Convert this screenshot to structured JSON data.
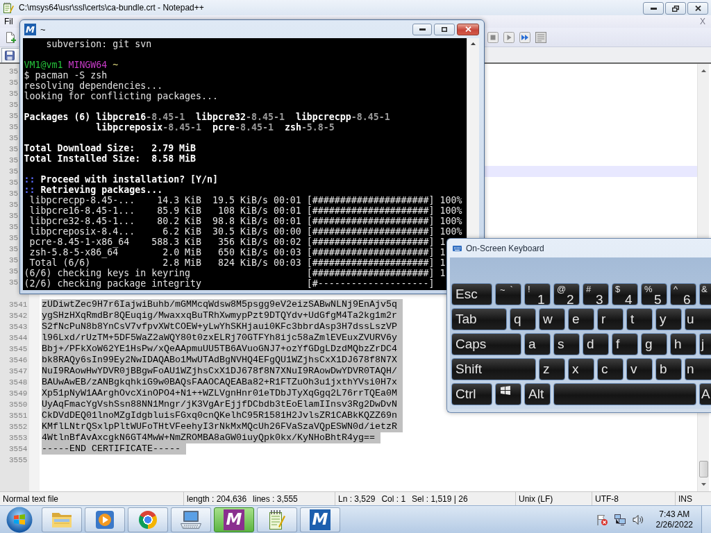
{
  "notepad": {
    "title": "C:\\msys64\\usr\\ssl\\certs\\ca-bundle.crt - Notepad++",
    "menu": {
      "items": [
        "Fil"
      ],
      "close": "X"
    },
    "editor": {
      "lines": [
        {
          "number": "35",
          "current": false
        },
        {
          "number": "35",
          "current": false
        },
        {
          "number": "35",
          "current": false
        },
        {
          "number": "35",
          "current": false
        },
        {
          "number": "35",
          "current": false
        },
        {
          "number": "35",
          "current": false
        },
        {
          "number": "35",
          "current": false
        },
        {
          "number": "35",
          "current": false
        },
        {
          "number": "35",
          "current": false
        },
        {
          "number": "35",
          "current": true
        },
        {
          "number": "35",
          "current": false
        },
        {
          "number": "35",
          "current": false
        },
        {
          "number": "35",
          "current": false
        },
        {
          "number": "35",
          "current": false
        },
        {
          "number": "35",
          "current": false
        },
        {
          "number": "35",
          "current": false
        },
        {
          "number": "35",
          "current": false
        },
        {
          "number": "35",
          "current": false
        },
        {
          "number": "35",
          "current": false
        },
        {
          "number": "35",
          "current": false
        },
        {
          "current": false
        },
        {
          "number": "3541",
          "text": "zUDiwtZec9H7r6IajwiBuhb/mGMMcqWdsw8M5psgg9eV2eizSABwNLNj9EnAjv5q",
          "selected": true,
          "current": false
        },
        {
          "number": "3542",
          "text": "ygSHzHXqRmdBr8QEuqig/MwaxxqBuTRhXwmypPzt9DTQYdv+UdGfgM4Ta2kg1m2r",
          "selected": true,
          "current": false
        },
        {
          "number": "3543",
          "text": "S2fNcPuN8b8YnCsV7vfpvXWtCOEW+yLwYhSKHjaui0KFc3bbrdAsp3H7dssLszVP",
          "selected": true,
          "current": false
        },
        {
          "number": "3544",
          "text": "l96Lxd/rUzTM+5DF5WaZ2aWQY80t0zxELRj70GTFYh8ijc58aZmlEVEuxZVURV6y",
          "selected": true,
          "current": false
        },
        {
          "number": "3545",
          "text": "Bbj+/PFkXoW62YE1HsPw/xQeAApmuUU5TB6AVuoGNJ7+ozYfGDgLDzdMQbzZrDC4",
          "selected": true,
          "current": false
        },
        {
          "number": "3546",
          "text": "bk8RAQy6sIn99Ey2NwIDAQABo1MwUTAdBgNVHQ4EFgQU1WZjhsCxX1DJ678f8N7X",
          "selected": true,
          "current": false
        },
        {
          "number": "3547",
          "text": "NuI9RAowHwYDVR0jBBgwFoAU1WZjhsCxX1DJ678f8N7XNuI9RAowDwYDVR0TAQH/",
          "selected": true,
          "current": false
        },
        {
          "number": "3548",
          "text": "BAUwAwEB/zANBgkqhkiG9w0BAQsFAAOCAQEABa82+R1FTZuOh3u1jxthYVsi0H7x",
          "selected": true,
          "current": false
        },
        {
          "number": "3549",
          "text": "Xp51pNyW1AArghOvcXinOPO4+N1++WZLVgnHnr01eTDbJTyXqGgq2L76rrTQEa0M",
          "selected": true,
          "current": false
        },
        {
          "number": "3550",
          "text": "UyAqFmacYgVshSsn88NN1Mngr/jK3VgArEjjfDCbdb3tEoElamIInsv3Rg2DwDvN",
          "selected": true,
          "current": false
        },
        {
          "number": "3551",
          "text": "CkDVdDEQ01lnoMZgIdgbluisFGxq0cnQKelhC95R1581H2JvlsZR1CABkKQZZ69n",
          "selected": true,
          "current": false
        },
        {
          "number": "3552",
          "text": "KMflLNtrQSxlpPltWUFoTHtVFeehyI3rNkMxMQcUh26FVaSzaVQpESWN0d/ietzR",
          "selected": true,
          "current": false
        },
        {
          "number": "3553",
          "text": "4WtlnBfAvAxcgkN6GT4MwW+NmZROMBA8aGW0iuyQpk0kx/KyNHoBhtR4yg==",
          "selected": true,
          "current": false
        },
        {
          "number": "3554",
          "text": "-----END CERTIFICATE-----",
          "selected": true,
          "current": false
        },
        {
          "number": "3555",
          "selected": false,
          "current": false
        }
      ]
    },
    "status_bar": [
      {
        "items": [
          "Normal text file"
        ]
      },
      {
        "items": [
          "length : 204,636",
          "lines : 3,555"
        ]
      },
      {
        "items": [
          "Ln : 3,529",
          "Col : 1",
          "Sel : 1,519 | 26"
        ]
      },
      {
        "items": [
          "Unix (LF)"
        ]
      },
      {
        "items": [
          "UTF-8"
        ]
      },
      {
        "items": [
          "INS"
        ]
      }
    ]
  },
  "terminal": {
    "logo": "M",
    "title": "~",
    "lines": [
      {
        "kind": "text",
        "segments": [
          {
            "text": "    subversion: git svn",
            "kind": "normal"
          }
        ]
      },
      {
        "kind": "blank"
      },
      {
        "kind": "text",
        "segments": [
          {
            "text": "VM1@vm1 ",
            "kind": "user"
          },
          {
            "text": "MINGW64 ",
            "kind": "host"
          },
          {
            "text": "~",
            "kind": "path"
          }
        ]
      },
      {
        "kind": "text",
        "segments": [
          {
            "text": "$ pacman -S zsh",
            "kind": "normal"
          }
        ]
      },
      {
        "kind": "text",
        "segments": [
          {
            "text": "resolving dependencies...",
            "kind": "normal"
          }
        ]
      },
      {
        "kind": "text",
        "segments": [
          {
            "text": "looking for conflicting packages...",
            "kind": "normal"
          }
        ]
      },
      {
        "kind": "blank"
      },
      {
        "kind": "text",
        "segments": [
          {
            "text": "Packages (6) libpcre16",
            "kind": "bold"
          },
          {
            "text": "-8.45-1  ",
            "kind": "dim"
          },
          {
            "text": "libpcre32",
            "kind": "bold"
          },
          {
            "text": "-8.45-1  ",
            "kind": "dim"
          },
          {
            "text": "libpcrecpp",
            "kind": "bold"
          },
          {
            "text": "-8.45-1",
            "kind": "dim"
          }
        ]
      },
      {
        "kind": "text",
        "segments": [
          {
            "text": "             libpcreposix",
            "kind": "bold"
          },
          {
            "text": "-8.45-1  ",
            "kind": "dim"
          },
          {
            "text": "pcre",
            "kind": "bold"
          },
          {
            "text": "-8.45-1  ",
            "kind": "dim"
          },
          {
            "text": "zsh",
            "kind": "bold"
          },
          {
            "text": "-5.8-5",
            "kind": "dim"
          }
        ]
      },
      {
        "kind": "blank"
      },
      {
        "kind": "text",
        "segments": [
          {
            "text": "Total Download Size:   2.79 MiB",
            "kind": "bold"
          }
        ]
      },
      {
        "kind": "text",
        "segments": [
          {
            "text": "Total Installed Size:  8.58 MiB",
            "kind": "bold"
          }
        ]
      },
      {
        "kind": "blank"
      },
      {
        "kind": "text",
        "segments": [
          {
            "text": ":: ",
            "kind": "marker"
          },
          {
            "text": "Proceed with installation? [Y/n]",
            "kind": "bold"
          }
        ]
      },
      {
        "kind": "text",
        "segments": [
          {
            "text": ":: ",
            "kind": "marker"
          },
          {
            "text": "Retrieving packages...",
            "kind": "bold"
          }
        ]
      },
      {
        "kind": "text",
        "segments": [
          {
            "text": " libpcrecpp-8.45-...    14.3 KiB  19.5 KiB/s 00:01 [#####################] 100%",
            "kind": "normal"
          }
        ]
      },
      {
        "kind": "text",
        "segments": [
          {
            "text": " libpcre16-8.45-1...    85.9 KiB   108 KiB/s 00:01 [#####################] 100%",
            "kind": "normal"
          }
        ]
      },
      {
        "kind": "text",
        "segments": [
          {
            "text": " libpcre32-8.45-1...    80.2 KiB  98.8 KiB/s 00:01 [#####################] 100%",
            "kind": "normal"
          }
        ]
      },
      {
        "kind": "text",
        "segments": [
          {
            "text": " libpcreposix-8.4...     6.2 KiB  30.5 KiB/s 00:00 [#####################] 100%",
            "kind": "normal"
          }
        ]
      },
      {
        "kind": "text",
        "segments": [
          {
            "text": " pcre-8.45-1-x86_64    588.3 KiB   356 KiB/s 00:02 [#####################] 1",
            "kind": "normal"
          }
        ]
      },
      {
        "kind": "text",
        "segments": [
          {
            "text": " zsh-5.8-5-x86_64        2.0 MiB   650 KiB/s 00:03 [#####################] 1",
            "kind": "normal"
          }
        ]
      },
      {
        "kind": "text",
        "segments": [
          {
            "text": " Total (6/6)             2.8 MiB   824 KiB/s 00:03 [#####################] 1",
            "kind": "normal"
          }
        ]
      },
      {
        "kind": "text",
        "segments": [
          {
            "text": "(6/6) checking keys in keyring                     [#####################] 1",
            "kind": "normal"
          }
        ]
      },
      {
        "kind": "text",
        "segments": [
          {
            "text": "(2/6) checking package integrity                   [#--------------------]",
            "kind": "normal"
          }
        ]
      }
    ]
  },
  "keyboard": {
    "title": "On-Screen Keyboard",
    "rows": [
      {
        "keys": [
          {
            "kind": "esc",
            "label": "Esc"
          },
          {
            "kind": "pair",
            "shift": "~",
            "label": "`"
          },
          {
            "kind": "dual",
            "shift": "!",
            "label": "1"
          },
          {
            "kind": "dual",
            "shift": "@",
            "label": "2"
          },
          {
            "kind": "dual",
            "shift": "#",
            "label": "3"
          },
          {
            "kind": "dual",
            "shift": "$",
            "label": "4"
          },
          {
            "kind": "dual",
            "shift": "%",
            "label": "5"
          },
          {
            "kind": "dual",
            "shift": "^",
            "label": "6"
          },
          {
            "kind": "dual",
            "shift": "&"
          }
        ]
      },
      {
        "keys": [
          {
            "kind": "tab",
            "label": "Tab"
          },
          {
            "kind": "letter",
            "label": "q"
          },
          {
            "kind": "letter",
            "label": "w"
          },
          {
            "kind": "letter",
            "label": "e"
          },
          {
            "kind": "letter",
            "label": "r"
          },
          {
            "kind": "letter",
            "label": "t"
          },
          {
            "kind": "letter",
            "label": "y"
          },
          {
            "kind": "letter",
            "label": "u"
          }
        ]
      },
      {
        "keys": [
          {
            "kind": "caps",
            "label": "Caps"
          },
          {
            "kind": "letter",
            "label": "a"
          },
          {
            "kind": "letter",
            "label": "s"
          },
          {
            "kind": "letter",
            "label": "d"
          },
          {
            "kind": "letter",
            "label": "f"
          },
          {
            "kind": "letter",
            "label": "g"
          },
          {
            "kind": "letter",
            "label": "h"
          },
          {
            "kind": "letter",
            "label": "j"
          }
        ]
      },
      {
        "keys": [
          {
            "kind": "shift",
            "label": "Shift"
          },
          {
            "kind": "letter",
            "label": "z"
          },
          {
            "kind": "letter",
            "label": "x"
          },
          {
            "kind": "letter",
            "label": "c"
          },
          {
            "kind": "letter",
            "label": "v"
          },
          {
            "kind": "letter",
            "label": "b"
          },
          {
            "kind": "letter",
            "label": "n"
          }
        ]
      },
      {
        "keys": [
          {
            "kind": "ctrl",
            "label": "Ctrl"
          },
          {
            "kind": "win"
          },
          {
            "kind": "alt",
            "label": "Alt"
          },
          {
            "kind": "space"
          },
          {
            "kind": "alt",
            "label": "A"
          }
        ]
      }
    ]
  },
  "taskbar": {
    "buttons": [
      {
        "kind": "folder",
        "selected": false
      },
      {
        "kind": "media",
        "selected": false
      },
      {
        "kind": "browser",
        "selected": false
      },
      {
        "kind": "keyboard",
        "selected": false
      },
      {
        "kind": "msys",
        "letter": "M",
        "selected": true
      },
      {
        "kind": "notepad",
        "selected": false
      },
      {
        "kind": "mintty",
        "letter": "M",
        "selected": false
      }
    ],
    "clock": {
      "time": "7:43 AM",
      "date": "2/26/2022"
    }
  }
}
